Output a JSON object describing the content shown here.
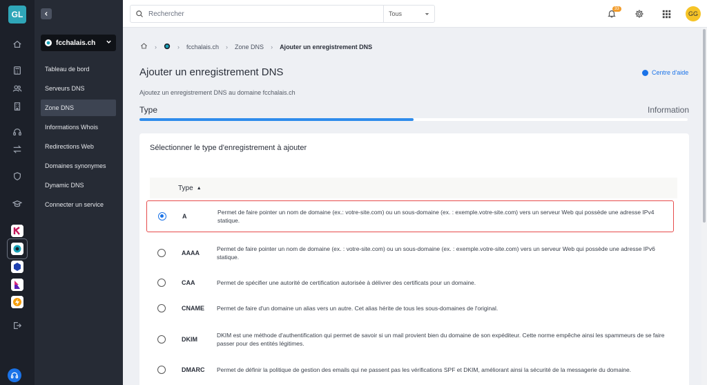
{
  "rail": {
    "logo": "GL"
  },
  "sidebar": {
    "domain": "fcchalais.ch",
    "items": [
      {
        "label": "Tableau de bord",
        "active": false
      },
      {
        "label": "Serveurs DNS",
        "active": false
      },
      {
        "label": "Zone DNS",
        "active": true
      },
      {
        "label": "Informations Whois",
        "active": false
      },
      {
        "label": "Redirections Web",
        "active": false
      },
      {
        "label": "Domaines synonymes",
        "active": false
      },
      {
        "label": "Dynamic DNS",
        "active": false
      },
      {
        "label": "Connecter un service",
        "active": false
      }
    ]
  },
  "topbar": {
    "search_placeholder": "Rechercher",
    "filter_value": "Tous",
    "notification_count": "33",
    "avatar_initials": "GG"
  },
  "breadcrumb": {
    "items": [
      "fcchalais.ch",
      "Zone DNS"
    ],
    "current": "Ajouter un enregistrement DNS"
  },
  "page": {
    "title": "Ajouter un enregistrement DNS",
    "help_label": "Centre d'aide",
    "subtitle": "Ajoutez un enregistrement DNS au domaine fcchalais.ch",
    "step_current": "Type",
    "step_next": "Information",
    "progress_fraction": 0.5
  },
  "card": {
    "title": "Sélectionner le type d'enregistrement à ajouter",
    "column_header": "Type",
    "rows": [
      {
        "type": "A",
        "description": "Permet de faire pointer un nom de domaine (ex.: votre-site.com) ou un sous-domaine (ex. : exemple.votre-site.com) vers un serveur Web qui possède une adresse IPv4 statique.",
        "selected": true
      },
      {
        "type": "AAAA",
        "description": "Permet de faire pointer un nom de domaine (ex. : votre-site.com) ou un sous-domaine (ex. : exemple.votre-site.com) vers un serveur Web qui possède une adresse IPv6 statique.",
        "selected": false
      },
      {
        "type": "CAA",
        "description": "Permet de spécifier une autorité de certification autorisée à délivrer des certificats pour un domaine.",
        "selected": false
      },
      {
        "type": "CNAME",
        "description": "Permet de faire d'un domaine un alias vers un autre. Cet alias hérite de tous les sous-domaines de l'original.",
        "selected": false
      },
      {
        "type": "DKIM",
        "description": "DKIM est une méthode d'authentification qui permet de savoir si un mail provient bien du domaine de son expéditeur. Cette norme empêche ainsi les spammeurs de se faire passer pour des entités légitimes.",
        "selected": false
      },
      {
        "type": "DMARC",
        "description": "Permet de définir la politique de gestion des emails qui ne passent pas les vérifications SPF et DKIM, améliorant ainsi la sécurité de la messagerie du domaine.",
        "selected": false
      }
    ]
  },
  "colors": {
    "accent": "#1a73e8",
    "progress": "#2f8ceb",
    "selection_border": "#e64a4a",
    "rail_bg": "#1c2029",
    "sidebar_bg": "#262b35"
  }
}
